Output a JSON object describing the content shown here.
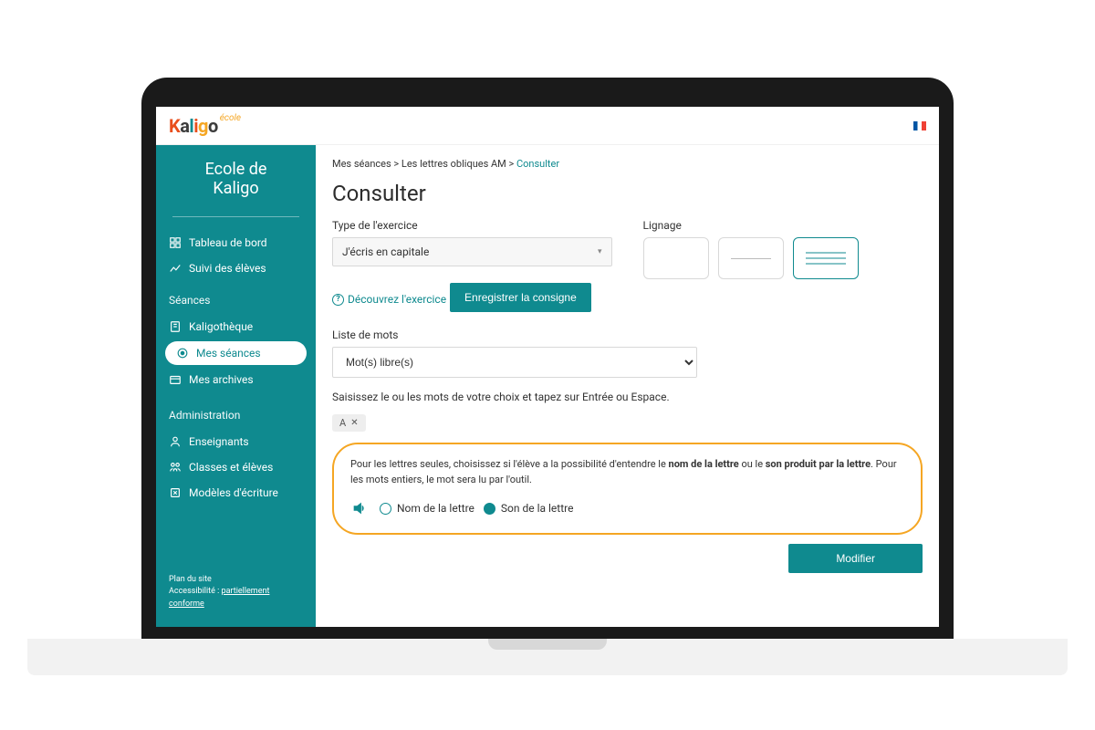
{
  "header": {
    "logo_suffix": "école"
  },
  "sidebar": {
    "school_line1": "Ecole de",
    "school_line2": "Kaligo",
    "tableau": "Tableau de bord",
    "suivi": "Suivi des élèves",
    "seances_label": "Séances",
    "kaligotheque": "Kaligothèque",
    "mes_seances": "Mes séances",
    "mes_archives": "Mes archives",
    "admin_label": "Administration",
    "enseignants": "Enseignants",
    "classes": "Classes et élèves",
    "modeles": "Modèles d'écriture",
    "footer_plan": "Plan du site",
    "footer_access_label": "Accessibilité : ",
    "footer_access_link": "partiellement conforme"
  },
  "breadcrumb": {
    "l1": "Mes séances",
    "l2": "Les lettres obliques AM",
    "l3": "Consulter"
  },
  "main": {
    "title": "Consulter",
    "type_label": "Type de l'exercice",
    "type_value": "J'écris en capitale",
    "discover": "Découvrez l'exercice",
    "record": "Enregistrer la consigne",
    "lineage_label": "Lignage",
    "wordlist_label": "Liste de mots",
    "wordlist_value": "Mot(s) libre(s)",
    "input_hint": "Saisissez le ou les mots de votre choix et tapez sur Entrée ou Espace.",
    "chip": "A",
    "audio_desc_pre": "Pour les lettres seules, choisissez si l'élève a la possibilité d'entendre le ",
    "audio_desc_b1": "nom de la lettre",
    "audio_desc_mid": " ou le ",
    "audio_desc_b2": "son produit par la lettre",
    "audio_desc_post": ". Pour les mots entiers, le mot sera lu par l'outil.",
    "radio_nom": "Nom de la lettre",
    "radio_son": "Son de la lettre",
    "modify": "Modifier"
  }
}
